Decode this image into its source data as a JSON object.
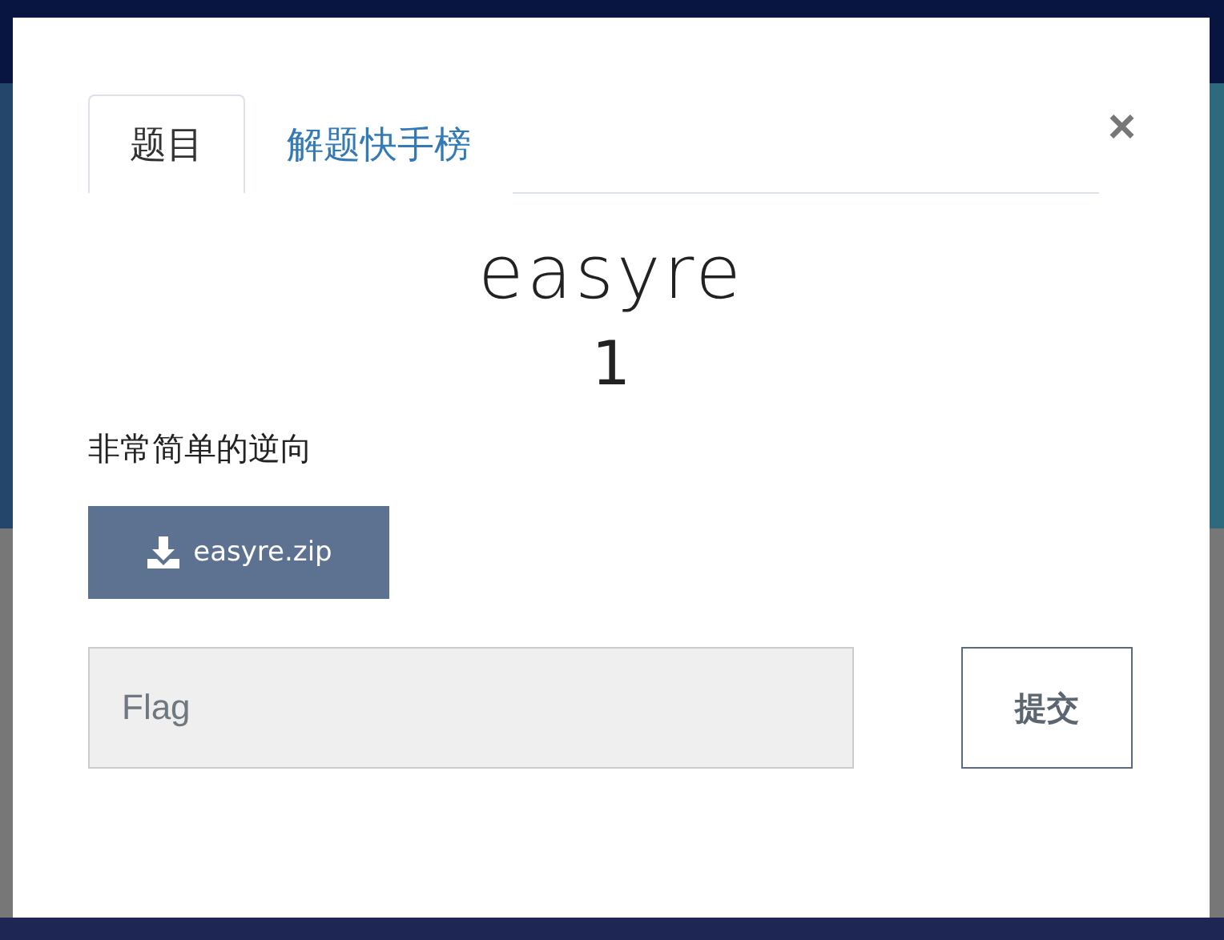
{
  "modal": {
    "tabs": [
      {
        "label": "题目",
        "selected": true
      },
      {
        "label": "解题快手榜",
        "selected": false
      }
    ],
    "close": "×",
    "title": "easyre",
    "points": "1",
    "description": "非常简单的逆向",
    "download": {
      "label": "easyre.zip"
    },
    "flag_field": {
      "placeholder": "Flag"
    },
    "submit": "提交"
  }
}
